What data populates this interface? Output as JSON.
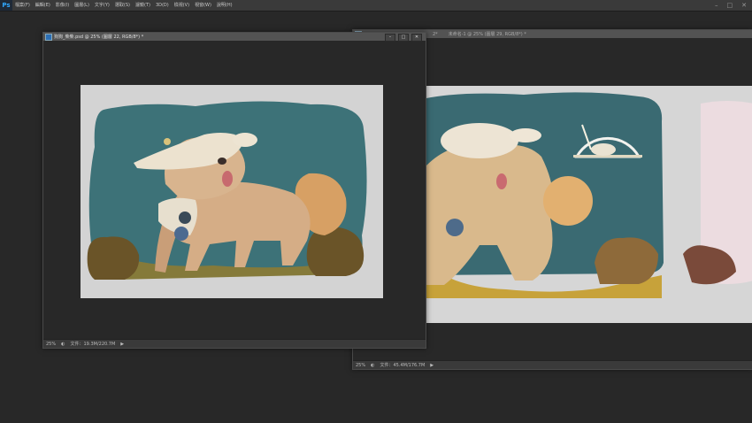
{
  "app": {
    "logo": "Ps"
  },
  "menu": [
    {
      "label": "檔案(F)"
    },
    {
      "label": "編輯(E)"
    },
    {
      "label": "影像(I)"
    },
    {
      "label": "圖層(L)"
    },
    {
      "label": "文字(Y)"
    },
    {
      "label": "選取(S)"
    },
    {
      "label": "濾鏡(T)"
    },
    {
      "label": "3D(D)"
    },
    {
      "label": "檢視(V)"
    },
    {
      "label": "視窗(W)"
    },
    {
      "label": "說明(H)"
    }
  ],
  "window_controls": {
    "minimize": "–",
    "restore": "□",
    "close": "✕"
  },
  "doc_front": {
    "title": "狗狗_柴柴.psd @ 25% (圖層 22, RGB/8*) *",
    "zoom": "25%",
    "file_size": "文件：19.3M/220.7M",
    "btn_min": "–",
    "btn_max": "□",
    "btn_close": "✕"
  },
  "doc_back": {
    "title_left": "2*",
    "title": "未命名-1 @ 25% (圖層 29, RGB/8*) *",
    "zoom": "25%",
    "file_size": "文件：45.4M/176.7M"
  },
  "colors": {
    "teal": "#3d7278",
    "canvas_grey": "#d3d3d3",
    "dog_body": "#d8b58e",
    "dog_orange": "#d89a5a",
    "bush": "#6a5428",
    "ground": "#8a7a3a"
  },
  "icons": {
    "ps_logo": "ps-logo-icon",
    "doc": "document-icon",
    "status_arrow": "triangle-right-icon"
  }
}
